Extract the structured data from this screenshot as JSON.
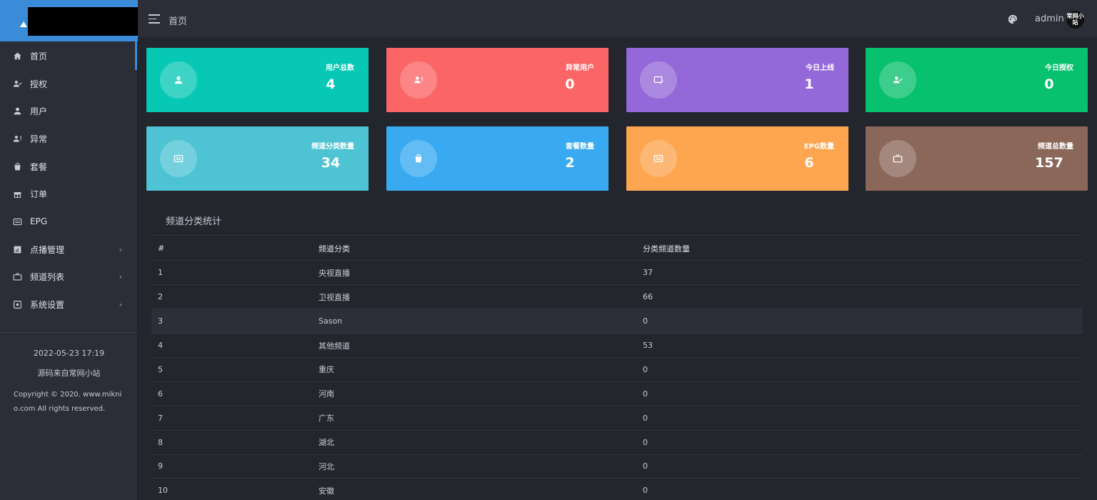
{
  "sidebar": {
    "items": [
      {
        "icon": "home-icon",
        "label": "首页",
        "chevron": ""
      },
      {
        "icon": "user-check-icon",
        "label": "授权",
        "chevron": ""
      },
      {
        "icon": "user-icon",
        "label": "用户",
        "chevron": ""
      },
      {
        "icon": "user-alert-icon",
        "label": "异常",
        "chevron": ""
      },
      {
        "icon": "bag-icon",
        "label": "套餐",
        "chevron": ""
      },
      {
        "icon": "gift-icon",
        "label": "订单",
        "chevron": ""
      },
      {
        "icon": "epg-icon",
        "label": "EPG",
        "chevron": ""
      },
      {
        "icon": "vod-icon",
        "label": "点播管理",
        "chevron": "›"
      },
      {
        "icon": "tv-icon",
        "label": "频道列表",
        "chevron": "›"
      },
      {
        "icon": "settings-icon",
        "label": "系统设置",
        "chevron": "›"
      }
    ],
    "footer": {
      "datetime": "2022-05-23 17:19",
      "source": "源码来自常网小站",
      "copyright": "Copyright © 2020. www.miknio.com All rights reserved."
    }
  },
  "header": {
    "breadcrumb": "首页",
    "username": "admin",
    "avatar_text": "常网小站"
  },
  "cards": [
    {
      "label": "用户总数",
      "value": "4",
      "color": "#07c7b5",
      "icon": "user-icon"
    },
    {
      "label": "异常用户",
      "value": "0",
      "color": "#fb6566",
      "icon": "user-alert-icon"
    },
    {
      "label": "今日上线",
      "value": "1",
      "color": "#9468d8",
      "icon": "online-icon"
    },
    {
      "label": "今日授权",
      "value": "0",
      "color": "#07c16e",
      "icon": "user-check-icon"
    },
    {
      "label": "频道分类数量",
      "value": "34",
      "color": "#4ec3d3",
      "icon": "epg-icon"
    },
    {
      "label": "套餐数量",
      "value": "2",
      "color": "#39aaf1",
      "icon": "bag-icon"
    },
    {
      "label": "EPG数量",
      "value": "6",
      "color": "#fea54f",
      "icon": "epg-icon"
    },
    {
      "label": "频道总数量",
      "value": "157",
      "color": "#8b6759",
      "icon": "tv-icon"
    }
  ],
  "stats": {
    "title": "频道分类统计",
    "columns": [
      "#",
      "频道分类",
      "分类频道数量"
    ],
    "rows": [
      [
        "1",
        "央视直播",
        "37"
      ],
      [
        "2",
        "卫视直播",
        "66"
      ],
      [
        "3",
        "Sason",
        "0"
      ],
      [
        "4",
        "其他频道",
        "53"
      ],
      [
        "5",
        "重庆",
        "0"
      ],
      [
        "6",
        "河南",
        "0"
      ],
      [
        "7",
        "广东",
        "0"
      ],
      [
        "8",
        "湖北",
        "0"
      ],
      [
        "9",
        "河北",
        "0"
      ],
      [
        "10",
        "安徽",
        "0"
      ]
    ]
  }
}
